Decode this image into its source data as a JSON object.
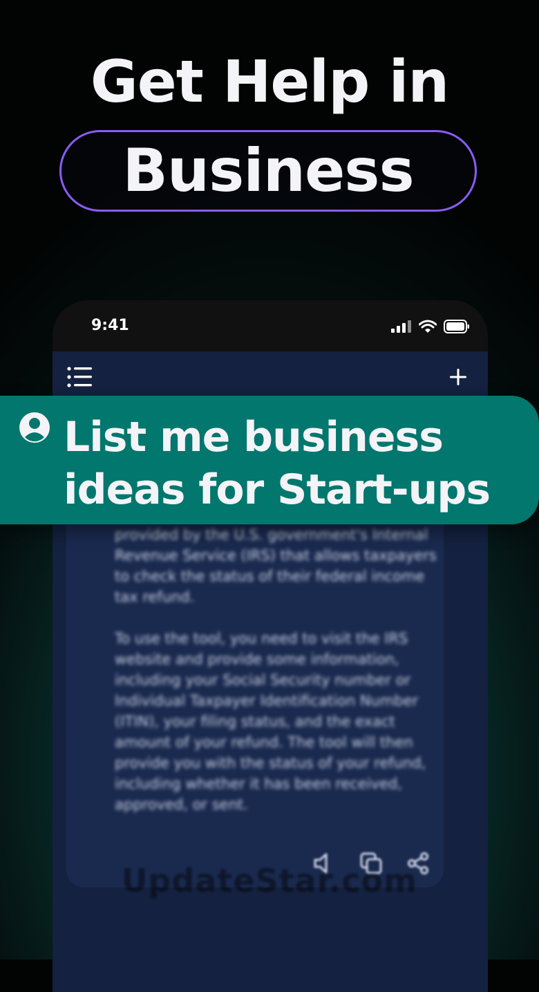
{
  "headline": {
    "title": "Get Help in",
    "highlight": "Business"
  },
  "phone": {
    "status_time": "9:41"
  },
  "prompt": {
    "text": "List me business ideas for Start-ups"
  },
  "answer": {
    "text": "provided by the U.S. government's Internal Revenue Service (IRS) that allows taxpayers to check the status of their federal income tax refund.\n\nTo use the tool, you need to visit the IRS website and provide some information, including your Social Security number or Individual Taxpayer Identification Number (ITIN), your filing status, and the exact amount of your refund. The tool will then provide you with the status of your refund, including whether it has been received, approved, or sent."
  },
  "watermark": "UpdateStar.com",
  "colors": {
    "accent": "#8b5cf6",
    "prompt_bg": "#01776e",
    "screen_bg": "#142140"
  }
}
